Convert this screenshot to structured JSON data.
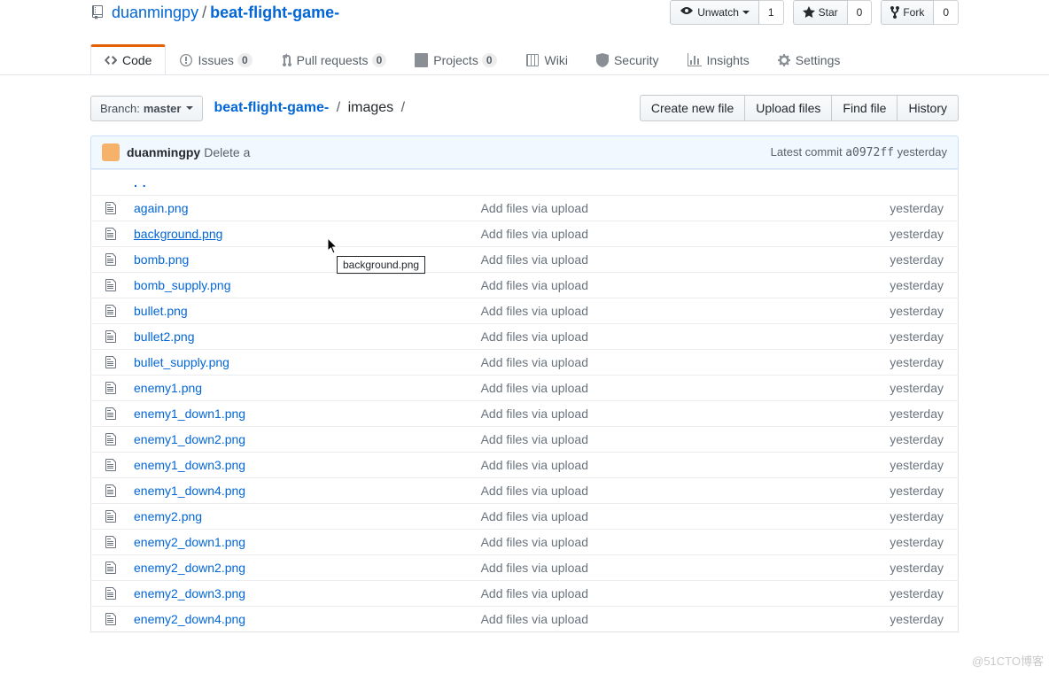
{
  "repo": {
    "owner": "duanmingpy",
    "name": "beat-flight-game-"
  },
  "actions": {
    "watch": {
      "label": "Unwatch",
      "count": "1"
    },
    "star": {
      "label": "Star",
      "count": "0"
    },
    "fork": {
      "label": "Fork",
      "count": "0"
    }
  },
  "tabs": {
    "code": {
      "label": "Code"
    },
    "issues": {
      "label": "Issues",
      "count": "0"
    },
    "pulls": {
      "label": "Pull requests",
      "count": "0"
    },
    "projects": {
      "label": "Projects",
      "count": "0"
    },
    "wiki": {
      "label": "Wiki"
    },
    "security": {
      "label": "Security"
    },
    "insights": {
      "label": "Insights"
    },
    "settings": {
      "label": "Settings"
    }
  },
  "branch": {
    "label": "Branch:",
    "name": "master"
  },
  "breadcrumb": {
    "root": "beat-flight-game-",
    "folder": "images"
  },
  "file_actions": {
    "new": "Create new file",
    "upload": "Upload files",
    "find": "Find file",
    "history": "History"
  },
  "commit_tease": {
    "author": "duanmingpy",
    "message": "Delete a",
    "latest_label": "Latest commit",
    "sha": "a0972ff",
    "when": "yesterday"
  },
  "tooltip": "background.png",
  "files": [
    {
      "name": "again.png",
      "message": "Add files via upload",
      "age": "yesterday"
    },
    {
      "name": "background.png",
      "message": "Add files via upload",
      "age": "yesterday",
      "hovered": true
    },
    {
      "name": "bomb.png",
      "message": "Add files via upload",
      "age": "yesterday"
    },
    {
      "name": "bomb_supply.png",
      "message": "Add files via upload",
      "age": "yesterday"
    },
    {
      "name": "bullet.png",
      "message": "Add files via upload",
      "age": "yesterday"
    },
    {
      "name": "bullet2.png",
      "message": "Add files via upload",
      "age": "yesterday"
    },
    {
      "name": "bullet_supply.png",
      "message": "Add files via upload",
      "age": "yesterday"
    },
    {
      "name": "enemy1.png",
      "message": "Add files via upload",
      "age": "yesterday"
    },
    {
      "name": "enemy1_down1.png",
      "message": "Add files via upload",
      "age": "yesterday"
    },
    {
      "name": "enemy1_down2.png",
      "message": "Add files via upload",
      "age": "yesterday"
    },
    {
      "name": "enemy1_down3.png",
      "message": "Add files via upload",
      "age": "yesterday"
    },
    {
      "name": "enemy1_down4.png",
      "message": "Add files via upload",
      "age": "yesterday"
    },
    {
      "name": "enemy2.png",
      "message": "Add files via upload",
      "age": "yesterday"
    },
    {
      "name": "enemy2_down1.png",
      "message": "Add files via upload",
      "age": "yesterday"
    },
    {
      "name": "enemy2_down2.png",
      "message": "Add files via upload",
      "age": "yesterday"
    },
    {
      "name": "enemy2_down3.png",
      "message": "Add files via upload",
      "age": "yesterday"
    },
    {
      "name": "enemy2_down4.png",
      "message": "Add files via upload",
      "age": "yesterday"
    }
  ],
  "watermark": "@51CTO博客"
}
